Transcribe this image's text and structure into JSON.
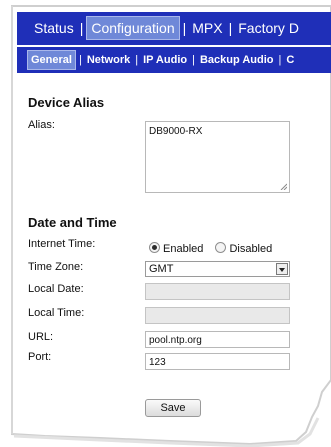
{
  "main_nav": {
    "items": [
      {
        "label": "Status",
        "active": false
      },
      {
        "label": "Configuration",
        "active": true
      },
      {
        "label": "MPX",
        "active": false
      },
      {
        "label": "Factory D",
        "active": false
      }
    ],
    "separator": "|"
  },
  "sub_nav": {
    "items": [
      {
        "label": "General",
        "active": true
      },
      {
        "label": "Network",
        "active": false
      },
      {
        "label": "IP Audio",
        "active": false
      },
      {
        "label": "Backup Audio",
        "active": false
      },
      {
        "label": "C",
        "active": false
      }
    ],
    "separator": "|"
  },
  "device_alias": {
    "heading": "Device Alias",
    "alias_label": "Alias:",
    "alias_value": "DB9000-RX"
  },
  "date_time": {
    "heading": "Date and Time",
    "internet_time_label": "Internet Time:",
    "enabled_label": "Enabled",
    "disabled_label": "Disabled",
    "internet_time_selected": "Enabled",
    "time_zone_label": "Time Zone:",
    "time_zone_value": "GMT",
    "local_date_label": "Local Date:",
    "local_date_value": "",
    "local_time_label": "Local Time:",
    "local_time_value": "",
    "url_label": "URL:",
    "url_value": "pool.ntp.org",
    "port_label": "Port:",
    "port_value": "123"
  },
  "actions": {
    "save_label": "Save"
  },
  "colors": {
    "nav_background": "#1f2fb8",
    "active_tab": "#6f88d8",
    "page_background": "#ffffff"
  }
}
